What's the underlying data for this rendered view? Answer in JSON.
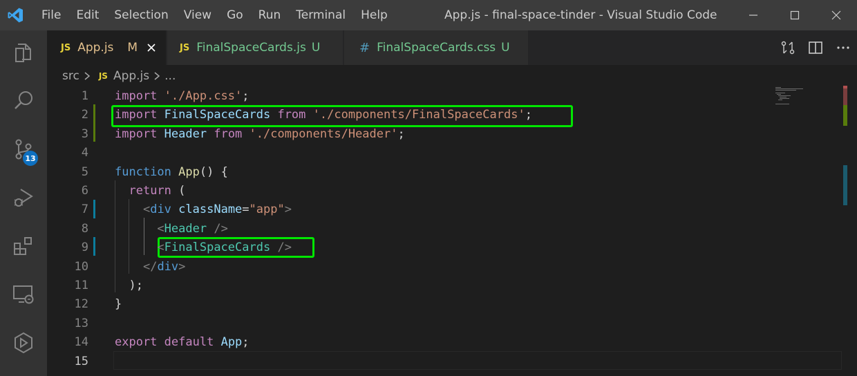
{
  "titlebar": {
    "menu": [
      "File",
      "Edit",
      "Selection",
      "View",
      "Go",
      "Run",
      "Terminal",
      "Help"
    ],
    "window_title": "App.js - final-space-tinder - Visual Studio Code",
    "controls": [
      "minimize-icon",
      "maximize-icon",
      "close-icon"
    ]
  },
  "activitybar": {
    "items": [
      "explorer-icon",
      "search-icon",
      "source-control-icon",
      "run-debug-icon",
      "extensions-icon",
      "remote-explorer-icon",
      "run-icon"
    ],
    "source_control_badge": "13"
  },
  "tabs": [
    {
      "icon": "JS",
      "label": "App.js",
      "status": "M",
      "active": true
    },
    {
      "icon": "JS",
      "label": "FinalSpaceCards.js",
      "status": "U",
      "active": false
    },
    {
      "icon": "#",
      "label": "FinalSpaceCards.css",
      "status": "U",
      "active": false
    }
  ],
  "editor_actions": [
    "compare-changes-icon",
    "split-editor-icon",
    "more-actions-icon"
  ],
  "breadcrumb": {
    "folder": "src",
    "file_icon": "JS",
    "file": "App.js",
    "more": "..."
  },
  "editor": {
    "line_numbers": [
      "1",
      "2",
      "3",
      "4",
      "5",
      "6",
      "7",
      "8",
      "9",
      "10",
      "11",
      "12",
      "13",
      "14",
      "15"
    ],
    "current_line": "15",
    "lines": [
      [
        [
          "kw",
          "import"
        ],
        [
          "plain",
          " "
        ],
        [
          "str",
          "'./App.css'"
        ],
        [
          "plain",
          ";"
        ]
      ],
      [
        [
          "kw",
          "import"
        ],
        [
          "plain",
          " "
        ],
        [
          "id",
          "FinalSpaceCards"
        ],
        [
          "plain",
          " "
        ],
        [
          "kw",
          "from"
        ],
        [
          "plain",
          " "
        ],
        [
          "str",
          "'./components/FinalSpaceCards'"
        ],
        [
          "plain",
          ";"
        ]
      ],
      [
        [
          "kw",
          "import"
        ],
        [
          "plain",
          " "
        ],
        [
          "id",
          "Header"
        ],
        [
          "plain",
          " "
        ],
        [
          "kw",
          "from"
        ],
        [
          "plain",
          " "
        ],
        [
          "str",
          "'./components/Header'"
        ],
        [
          "plain",
          ";"
        ]
      ],
      [],
      [
        [
          "storage",
          "function"
        ],
        [
          "plain",
          " "
        ],
        [
          "fn",
          "App"
        ],
        [
          "plain",
          "() {"
        ]
      ],
      [
        [
          "plain",
          "  "
        ],
        [
          "kw",
          "return"
        ],
        [
          "plain",
          " ("
        ]
      ],
      [
        [
          "plain",
          "    "
        ],
        [
          "punc",
          "<"
        ],
        [
          "html-tag",
          "div"
        ],
        [
          "plain",
          " "
        ],
        [
          "attr",
          "className"
        ],
        [
          "plain",
          "="
        ],
        [
          "str",
          "\"app\""
        ],
        [
          "punc",
          ">"
        ]
      ],
      [
        [
          "plain",
          "      "
        ],
        [
          "punc",
          "<"
        ],
        [
          "tag",
          "Header"
        ],
        [
          "plain",
          " "
        ],
        [
          "punc",
          "/>"
        ]
      ],
      [
        [
          "plain",
          "      "
        ],
        [
          "punc",
          "<"
        ],
        [
          "tag",
          "FinalSpaceCards"
        ],
        [
          "plain",
          " "
        ],
        [
          "punc",
          "/>"
        ]
      ],
      [
        [
          "plain",
          "    "
        ],
        [
          "punc",
          "</"
        ],
        [
          "html-tag",
          "div"
        ],
        [
          "punc",
          ">"
        ]
      ],
      [
        [
          "plain",
          "  );"
        ]
      ],
      [
        [
          "plain",
          "}"
        ]
      ],
      [],
      [
        [
          "kw",
          "export"
        ],
        [
          "plain",
          " "
        ],
        [
          "kw",
          "default"
        ],
        [
          "plain",
          " "
        ],
        [
          "id",
          "App"
        ],
        [
          "plain",
          ";"
        ]
      ],
      []
    ]
  },
  "colors": {
    "highlight": "#00e600",
    "git_added": "#587c0c",
    "git_modified": "#0c7d9d",
    "badge": "#0e70c0"
  }
}
